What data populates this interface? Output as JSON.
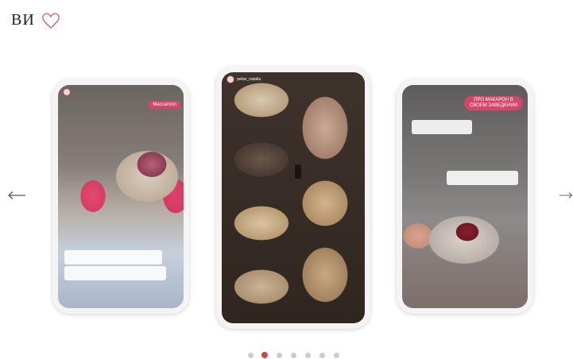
{
  "heading": {
    "text": "ВИ",
    "icon": "heart-outline-icon",
    "icon_color": "#e0616d"
  },
  "carousel": {
    "prev_icon": "arrow-left-icon",
    "next_icon": "arrow-right-icon",
    "slides": [
      {
        "position": "left",
        "tag": "Maccaroon",
        "captions": [
          "",
          ""
        ]
      },
      {
        "position": "center",
        "username": "pekar_natalia",
        "overlay_text": ""
      },
      {
        "position": "right",
        "tag": "ПРО МАКАРОН В СВОЕМ ЗАВЕДЕНИИ",
        "captions": [
          "",
          ""
        ]
      }
    ],
    "dots": {
      "count": 7,
      "active_index": 1,
      "active_color": "#d9453c",
      "inactive_color": "#cccccc"
    }
  }
}
